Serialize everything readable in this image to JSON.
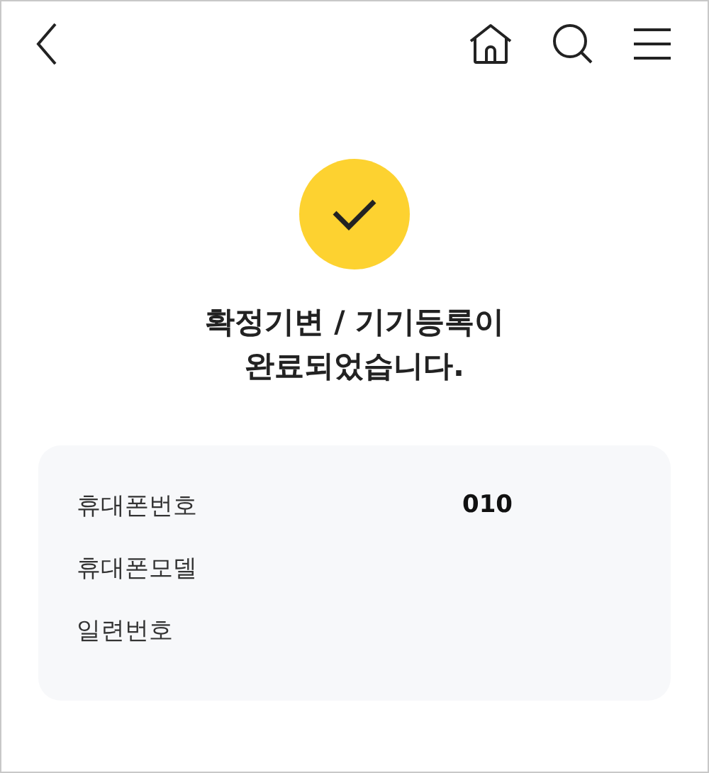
{
  "title": "확정기변 / 기기등록이\n완료되었습니다.",
  "details": [
    {
      "label": "휴대폰번호",
      "value": "010"
    },
    {
      "label": "휴대폰모델"
    },
    {
      "label": "일련번호"
    }
  ]
}
